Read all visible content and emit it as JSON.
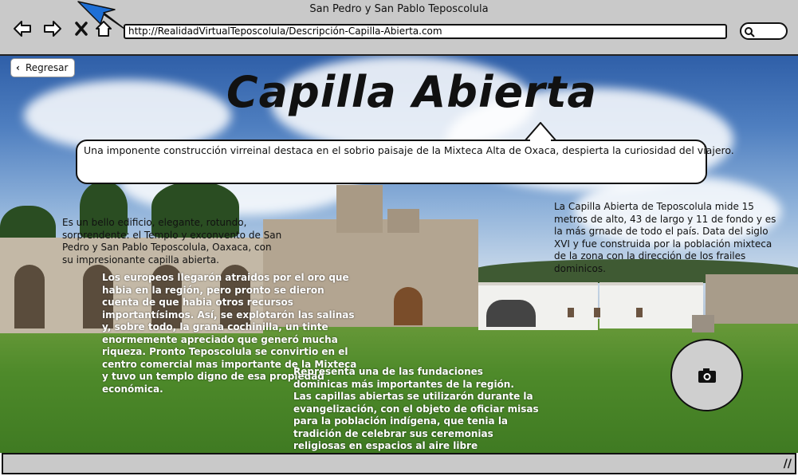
{
  "window": {
    "title": "San Pedro y San Pablo Teposcolula"
  },
  "address_bar": {
    "url": "http://RealidadVirtualTeposcolula/Descripción-Capilla-Abierta.com"
  },
  "nav": {
    "back_label": "Regresar"
  },
  "page": {
    "title": "Capilla Abierta",
    "callout": "Una imponente construcción virreinal destaca en el sobrio paisaje de la Mixteca Alta de Oxaca, despierta la curiosidad del viajero.",
    "para_left": "Es un bello edificio, elegante, rotundo, sorprendente: el Templo y exconvento de San Pedro y San Pablo Teposcolula, Oaxaca, con su impresionante capilla abierta.",
    "para_right": "La Capilla Abierta de Teposcolula mide 15 metros de alto, 43 de largo y 11 de fondo y es la más grnade de todo el país. Data del siglo XVI y fue construida por la población mixteca de la zona con la dirección de los frailes dominicos.",
    "para_history": "Los europeos llegarón atraidos por el oro que habia en la región, pero pronto se dieron cuenta de que habia otros recursos importantísimos. Así, se explotarón las salinas y, sobre todo, la grana cochinilla, un tinte enormemente apreciado que generó mucha riqueza. Pronto Teposcolula se convirtio en el centro comercial mas importante de la Mixteca y tuvo un templo digno de esa propiedad económica.",
    "para_dominicans": "Representa una de las fundaciones dominicas más importantes de la región.\nLas capillas abiertas se utilizarón durante la evangelización, con el objeto de oficiar misas para la población indígena, que tenia la tradición de celebrar sus ceremonias religiosas en espacios al aire libre"
  },
  "icons": {
    "back": "arrow-left-icon",
    "forward": "arrow-right-icon",
    "stop": "close-icon",
    "home": "home-icon",
    "search": "search-icon",
    "camera": "camera-icon"
  }
}
